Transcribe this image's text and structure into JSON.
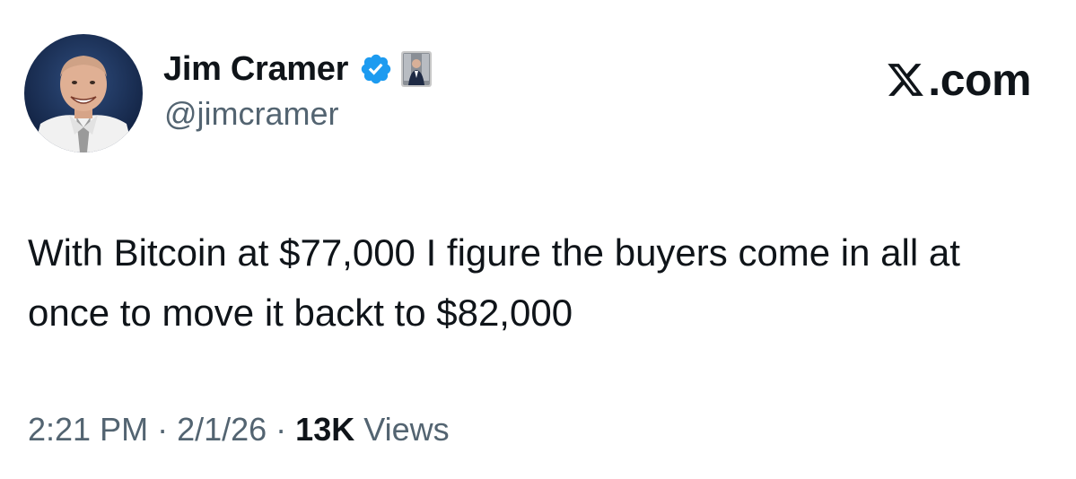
{
  "author": {
    "display_name": "Jim Cramer",
    "handle": "@jimcramer",
    "verified": true,
    "avatar": "profile-photo",
    "affiliate_badge": "nyse-floor-badge"
  },
  "brand": {
    "label": ".com",
    "logo": "x-logo-icon"
  },
  "tweet": {
    "text": "With Bitcoin at $77,000 I figure the buyers come in all at once to move it backt to $82,000"
  },
  "meta": {
    "time": "2:21 PM",
    "separator": "·",
    "date": "2/1/26",
    "views_count": "13K",
    "views_label": "Views"
  },
  "colors": {
    "text_primary": "#0f1419",
    "text_secondary": "#536471",
    "verified_blue": "#1d9bf0"
  }
}
